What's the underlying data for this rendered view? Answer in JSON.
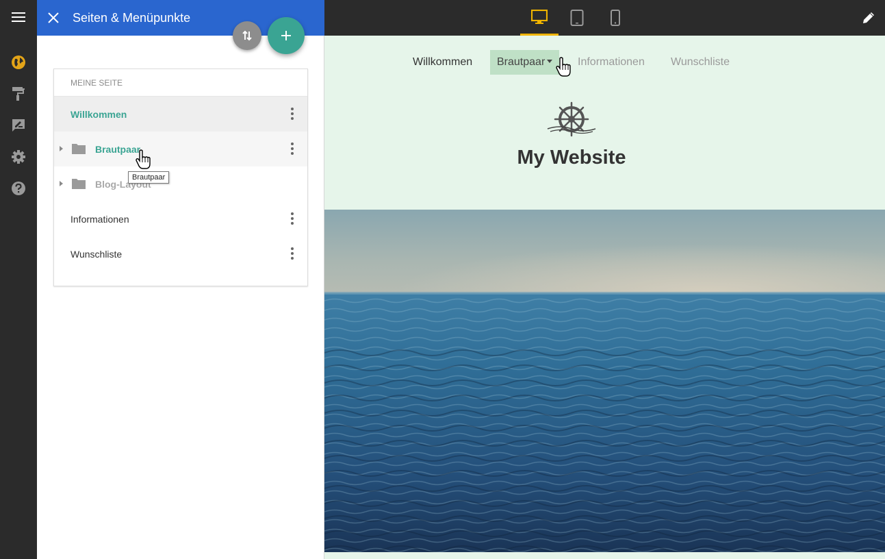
{
  "panel": {
    "title": "Seiten & Menüpunkte",
    "section_header": "MEINE SEITE",
    "pages": [
      {
        "label": "Willkommen"
      },
      {
        "label": "Brautpaar"
      },
      {
        "label": "Blog-Layout"
      },
      {
        "label": "Informationen"
      },
      {
        "label": "Wunschliste"
      }
    ],
    "tooltip": "Brautpaar"
  },
  "site": {
    "nav": [
      "Willkommen",
      "Brautpaar",
      "Informationen",
      "Wunschliste"
    ],
    "title": "My Website"
  },
  "rail_icons": [
    "globe-icon",
    "paint-roller-icon",
    "edit-note-icon",
    "gear-icon",
    "help-icon"
  ],
  "device_icons": [
    "desktop-icon",
    "tablet-icon",
    "phone-icon"
  ],
  "colors": {
    "panel_header": "#2a66cf",
    "accent_teal": "#3aa493",
    "device_active": "#f0b400",
    "preview_bg": "#e6f5ea",
    "nav_active_bg": "#bfe0c6"
  }
}
